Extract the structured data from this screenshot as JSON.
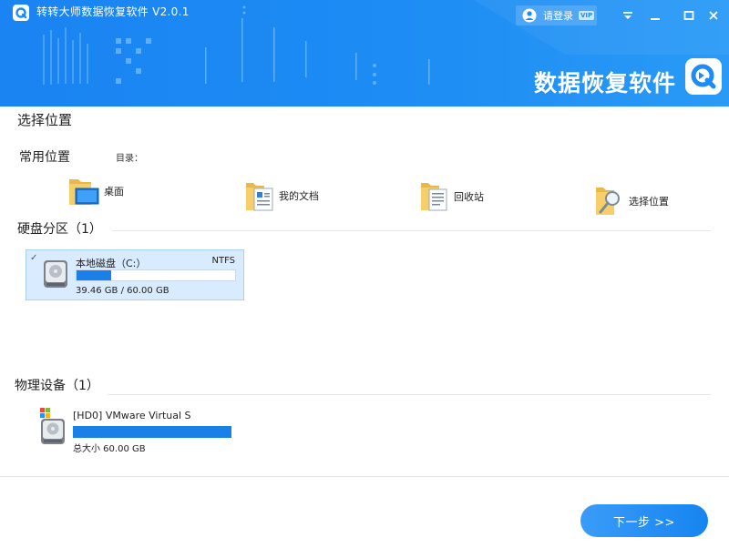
{
  "app": {
    "title": "转转大师数据恢复软件 V2.0.1",
    "brand_title": "数据恢复软件",
    "accent_color": "#1d8cf4"
  },
  "header": {
    "login_label": "请登录",
    "vip_badge": "VIP",
    "controls": [
      "menu-icon",
      "minimize-icon",
      "maximize-icon",
      "close-icon"
    ]
  },
  "page": {
    "title": "选择位置"
  },
  "common_locations": {
    "title": "常用位置",
    "dir_label": "目录：",
    "items": [
      {
        "label": "桌面",
        "icon": "desktop-folder-icon"
      },
      {
        "label": "我的文档",
        "icon": "documents-folder-icon"
      },
      {
        "label": "回收站",
        "icon": "recycle-bin-folder-icon"
      },
      {
        "label": "选择位置",
        "icon": "browse-folder-icon"
      }
    ]
  },
  "partitions": {
    "title": "硬盘分区（1）",
    "items": [
      {
        "name": "本地磁盘（C:）",
        "filesystem": "NTFS",
        "size_text": "39.46 GB / 60.00 GB",
        "used_fraction": 0.22,
        "selected": true
      }
    ]
  },
  "physical_devices": {
    "title": "物理设备（1）",
    "items": [
      {
        "name": "[HD0] VMware Virtual S",
        "size_text": "总大小 60.00 GB",
        "used_fraction": 1.0
      }
    ]
  },
  "footer": {
    "next_label": "下一步 >>"
  }
}
